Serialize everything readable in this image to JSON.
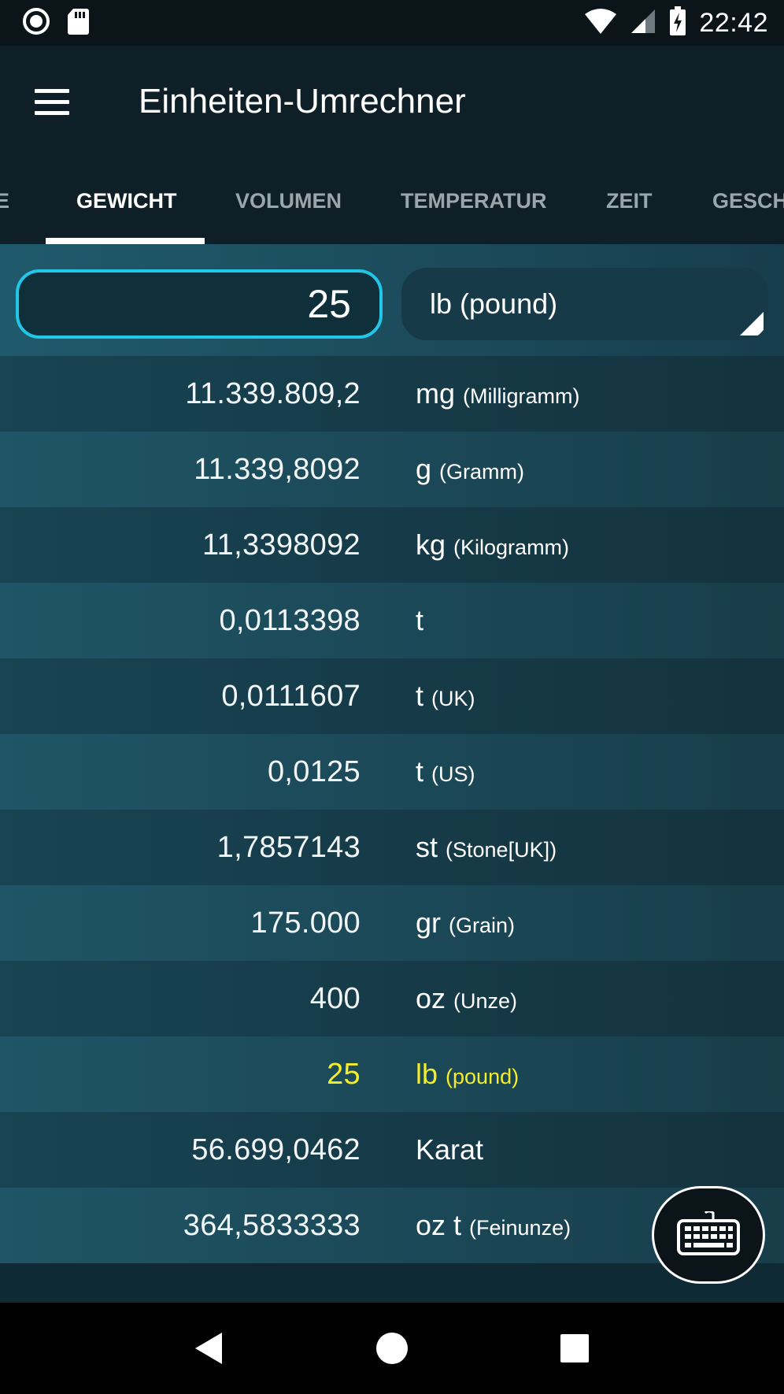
{
  "status_bar": {
    "time": "22:42",
    "icons": [
      "record-icon",
      "sd-card-icon",
      "wifi-icon",
      "signal-icon",
      "battery-charging-icon"
    ]
  },
  "app_bar": {
    "menu_icon": "hamburger-menu-icon",
    "title": "Einheiten-Umrechner"
  },
  "tabs": [
    {
      "label": "LÄNGE",
      "visible_label": "E",
      "active": false
    },
    {
      "label": "GEWICHT",
      "visible_label": "GEWICHT",
      "active": true
    },
    {
      "label": "VOLUMEN",
      "visible_label": "VOLUMEN",
      "active": false
    },
    {
      "label": "TEMPERATUR",
      "visible_label": "TEMPERATUR",
      "active": false
    },
    {
      "label": "ZEIT",
      "visible_label": "ZEIT",
      "active": false
    },
    {
      "label": "GESCHWINDIGKEIT",
      "visible_label": "GESCH",
      "active": false
    }
  ],
  "input": {
    "value": "25",
    "unit_selected": "lb (pound)"
  },
  "results": [
    {
      "value": "11.339.809,2",
      "unit": "mg",
      "desc": "(Milligramm)",
      "highlight": false
    },
    {
      "value": "11.339,8092",
      "unit": "g",
      "desc": "(Gramm)",
      "highlight": false
    },
    {
      "value": "11,3398092",
      "unit": "kg",
      "desc": "(Kilogramm)",
      "highlight": false
    },
    {
      "value": "0,0113398",
      "unit": "t",
      "desc": "",
      "highlight": false
    },
    {
      "value": "0,0111607",
      "unit": "t",
      "desc": "(UK)",
      "highlight": false
    },
    {
      "value": "0,0125",
      "unit": "t",
      "desc": "(US)",
      "highlight": false
    },
    {
      "value": "1,7857143",
      "unit": "st",
      "desc": "(Stone[UK])",
      "highlight": false
    },
    {
      "value": "175.000",
      "unit": "gr",
      "desc": "(Grain)",
      "highlight": false
    },
    {
      "value": "400",
      "unit": "oz",
      "desc": "(Unze)",
      "highlight": false
    },
    {
      "value": "25",
      "unit": "lb",
      "desc": "(pound)",
      "highlight": true
    },
    {
      "value": "56.699,0462",
      "unit": "Karat",
      "desc": "",
      "highlight": false
    },
    {
      "value": "364,5833333",
      "unit": "oz t",
      "desc": "(Feinunze)",
      "highlight": false
    }
  ],
  "fab": {
    "icon": "keyboard-icon"
  },
  "nav_bar": {
    "icons": [
      "back-icon",
      "home-icon",
      "recents-icon"
    ]
  },
  "colors": {
    "accent": "#22c7e8",
    "highlight": "#f4ee2a",
    "app_bar": "#0e1f27",
    "row_dark": "#184453",
    "row_light": "#1f5566"
  }
}
